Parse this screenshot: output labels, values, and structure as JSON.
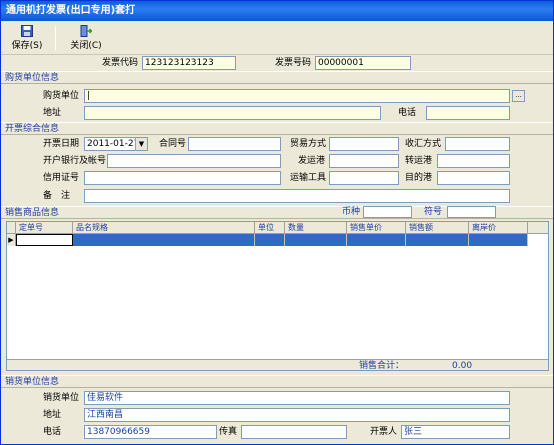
{
  "window": {
    "title": "通用机打发票(出口专用)套打"
  },
  "toolbar": {
    "save_label": "保存(S)",
    "close_label": "关闭(C)"
  },
  "header": {
    "invoice_code_label": "发票代码",
    "invoice_code_value": "123123123123",
    "invoice_no_label": "发票号码",
    "invoice_no_value": "00000001"
  },
  "buyer": {
    "section_title": "购货单位信息",
    "unit_label": "购货单位",
    "unit_value": "|",
    "address_label": "地址",
    "address_value": "",
    "phone_label": "电话",
    "phone_value": "",
    "lookup_label": "..."
  },
  "invoice_info": {
    "section_title": "开票综合信息",
    "date_label": "开票日期",
    "date_value": "2011-01-27",
    "contract_label": "合同号",
    "contract_value": "",
    "trade_label": "贸易方式",
    "trade_value": "",
    "payment_label": "收汇方式",
    "payment_value": "",
    "bank_label": "开户银行及帐号",
    "bank_value": "",
    "ship_from_label": "发运港",
    "ship_from_value": "",
    "transfer_label": "转运港",
    "transfer_value": "",
    "credit_label": "信用证号",
    "credit_value": "",
    "transport_label": "运输工具",
    "transport_value": "",
    "dest_label": "目的港",
    "dest_value": "",
    "remark_label": "备　注",
    "remark_value": ""
  },
  "sales": {
    "section_title": "销售商品信息",
    "currency_label": "币种",
    "currency_value": "",
    "symbol_label": "符号",
    "symbol_value": "",
    "columns": [
      "定单号",
      "品名规格",
      "单位",
      "数量",
      "销售单价",
      "销售额",
      "离岸价"
    ],
    "total_label": "销售合计：",
    "total_value": "0.00",
    "row_marker": "▶"
  },
  "seller": {
    "section_title": "销货单位信息",
    "unit_label": "销货单位",
    "unit_value": "佳易软件",
    "address_label": "地址",
    "address_value": "江西南昌",
    "phone_label": "电话",
    "phone_value": "13870966659",
    "fax_label": "传真",
    "fax_value": "",
    "drawer_label": "开票人",
    "drawer_value": "张三"
  },
  "colors": {
    "accent": "#1e3ea0",
    "selection": "#316ac5",
    "title_bar": "#0a5fd8"
  },
  "icons": {
    "save": "floppy-disk-icon",
    "close": "exit-door-icon",
    "dropdown": "chevron-down-icon"
  }
}
